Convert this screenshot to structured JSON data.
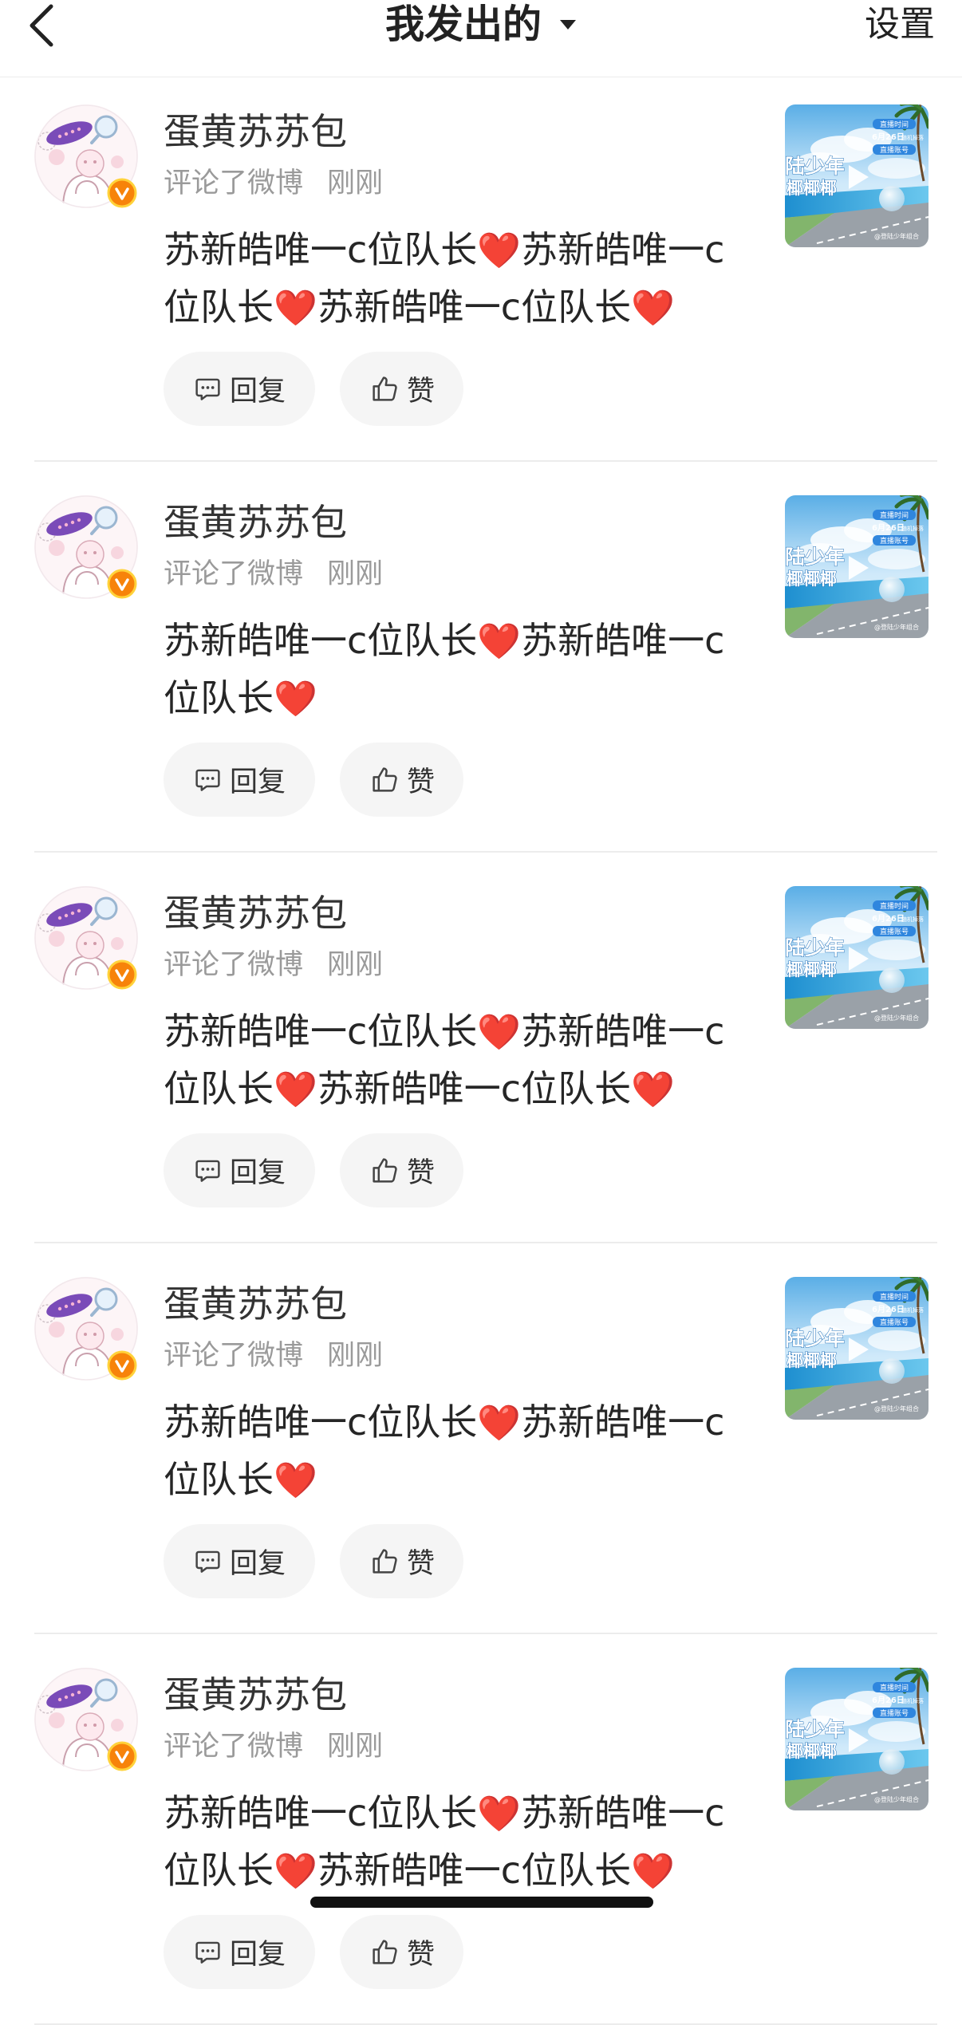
{
  "header": {
    "back_icon": "chevron-left-icon",
    "title": "我发出的",
    "dropdown_icon": "caret-down-icon",
    "settings_label": "设置"
  },
  "colors": {
    "verified_badge": "#f7830a",
    "heart": "#e0212d",
    "meta_text": "#9a9a9a",
    "pill_bg": "#f5f5f5"
  },
  "thumbnail": {
    "play_icon": "play-icon",
    "lettering": {
      "title_main": "陆少年",
      "title_sub": "椰椰椰",
      "tag_time": "直播时间",
      "date": "6月26日",
      "date_note": "随机掉落",
      "tag_account": "直播账号",
      "credit": "@登陆少年组合"
    }
  },
  "cards": [
    {
      "author": "蛋黄苏苏包",
      "verified": true,
      "action": "评论了微博",
      "time": "刚刚",
      "content": "苏新皓唯一c位队长❤️苏新皓唯一c位队长❤️苏新皓唯一c位队长❤️",
      "reply_label": "回复",
      "reply_icon": "comment-icon",
      "like_label": "赞",
      "like_icon": "thumbs-up-icon"
    },
    {
      "author": "蛋黄苏苏包",
      "verified": true,
      "action": "评论了微博",
      "time": "刚刚",
      "content": "苏新皓唯一c位队长❤️苏新皓唯一c位队长❤️",
      "reply_label": "回复",
      "reply_icon": "comment-icon",
      "like_label": "赞",
      "like_icon": "thumbs-up-icon"
    },
    {
      "author": "蛋黄苏苏包",
      "verified": true,
      "action": "评论了微博",
      "time": "刚刚",
      "content": "苏新皓唯一c位队长❤️苏新皓唯一c位队长❤️苏新皓唯一c位队长❤️",
      "reply_label": "回复",
      "reply_icon": "comment-icon",
      "like_label": "赞",
      "like_icon": "thumbs-up-icon"
    },
    {
      "author": "蛋黄苏苏包",
      "verified": true,
      "action": "评论了微博",
      "time": "刚刚",
      "content": "苏新皓唯一c位队长❤️苏新皓唯一c位队长❤️",
      "reply_label": "回复",
      "reply_icon": "comment-icon",
      "like_label": "赞",
      "like_icon": "thumbs-up-icon"
    },
    {
      "author": "蛋黄苏苏包",
      "verified": true,
      "action": "评论了微博",
      "time": "刚刚",
      "content": "苏新皓唯一c位队长❤️苏新皓唯一c位队长❤️苏新皓唯一c位队长❤️",
      "reply_label": "回复",
      "reply_icon": "comment-icon",
      "like_label": "赞",
      "like_icon": "thumbs-up-icon"
    }
  ]
}
